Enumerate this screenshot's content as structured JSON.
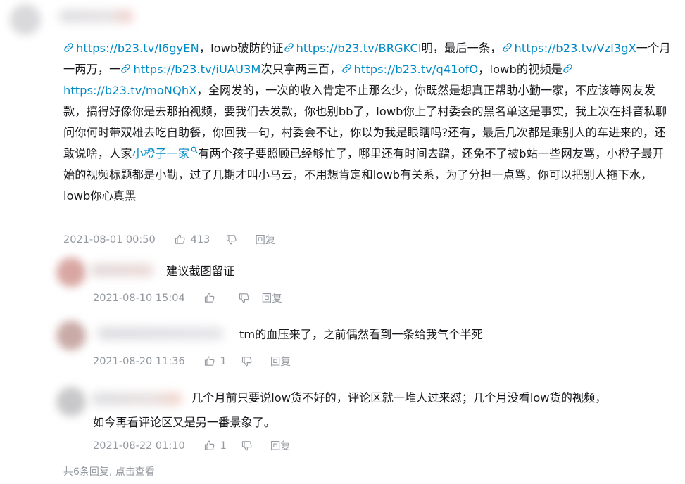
{
  "comment": {
    "segments": [
      {
        "type": "link",
        "text": "https://b23.tv/I6gyEN"
      },
      {
        "type": "text",
        "text": "，lowb破防的证"
      },
      {
        "type": "link",
        "text": "https://b23.tv/BRGKCl"
      },
      {
        "type": "text",
        "text": "明，最后一条，"
      },
      {
        "type": "link",
        "text": "https://b23.tv/Vzl3gX"
      },
      {
        "type": "text",
        "text": "一个月一两万，一"
      },
      {
        "type": "link",
        "text": "https://b23.tv/iUAU3M"
      },
      {
        "type": "text",
        "text": "次只拿两三百，"
      },
      {
        "type": "link",
        "text": "https://b23.tv/q41ofO"
      },
      {
        "type": "text",
        "text": "，lowb的视频是"
      },
      {
        "type": "link",
        "text": "https://b23.tv/moNQhX"
      },
      {
        "type": "text",
        "text": "，全网发的，一次的收入肯定不止那么少，你既然是想真正帮助小勤一家，不应该等网友发款，搞得好像你是去那拍视频，要我们去发款，你也别bb了，lowb你上了村委会的黑名单这是事实，我上次在抖音私聊问你何时带双雄去吃自助餐，你回我一句，村委会不让，你以为我是眼瞎吗?还有，最后几次都是乘别人的车进来的，还敢说啥，人家"
      },
      {
        "type": "keyword",
        "text": "小橙子一家"
      },
      {
        "type": "text",
        "text": "有两个孩子要照顾已经够忙了，哪里还有时间去蹭，还免不了被b站一些网友骂，小橙子最开始的视频标题都是小勤，过了几期才叫小马云，不用想肯定和lowb有关系，为了分担一点骂，你可以把别人拖下水，lowb你心真黑"
      }
    ],
    "time": "2021-08-01 00:50",
    "likes": "413",
    "reply_label": "回复"
  },
  "replies": [
    {
      "text": "建议截图留证",
      "time": "2021-08-10 15:04",
      "likes": "",
      "reply_label": "回复"
    },
    {
      "text": "tm的血压来了，之前偶然看到一条给我气个半死",
      "time": "2021-08-20 11:36",
      "likes": "1",
      "reply_label": "回复"
    },
    {
      "text_line1": "几个月前只要说low货不好的，评论区就一堆人过来怼；几个月没看low货的视频，",
      "text_line2": "如今再看评论区又是另一番景象了。",
      "time": "2021-08-22 01:10",
      "likes": "1",
      "reply_label": "回复"
    }
  ],
  "more_replies": "共6条回复, 点击查看",
  "colors": {
    "link": "#008ac5",
    "meta": "#9499a0",
    "text": "#18191c"
  },
  "icons": [
    "link-icon",
    "search-icon",
    "thumb-up-icon",
    "thumb-down-icon"
  ]
}
